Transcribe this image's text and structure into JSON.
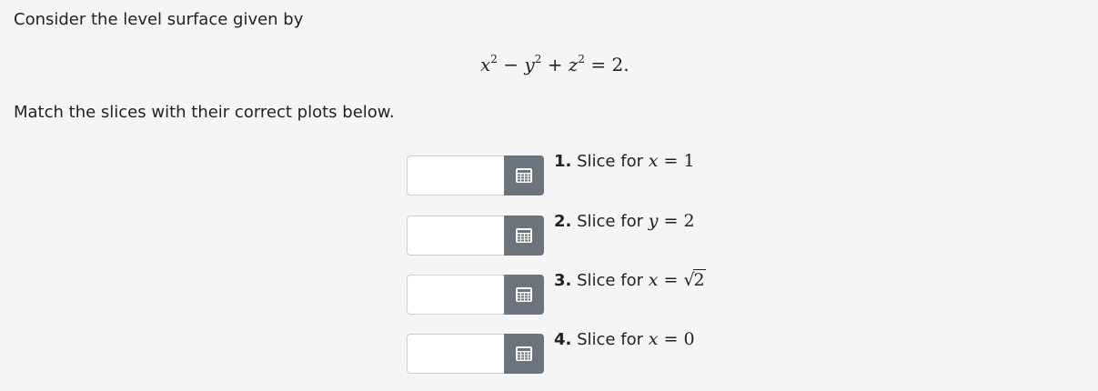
{
  "intro_text": "Consider the level surface given by",
  "equation": {
    "x": "x",
    "minus": " − ",
    "y": "y",
    "plus": " + ",
    "z": "z",
    "exp": "2",
    "equals": " = 2."
  },
  "instructions": "Match the slices with their correct plots below.",
  "slices": [
    {
      "number": "1.",
      "text": "Slice for",
      "variable": "x",
      "equals": " = ",
      "value": "1",
      "input_value": ""
    },
    {
      "number": "2.",
      "text": "Slice for",
      "variable": "y",
      "equals": " = ",
      "value": "2",
      "input_value": ""
    },
    {
      "number": "3.",
      "text": "Slice for",
      "variable": "x",
      "equals": " = ",
      "sqrt_symbol": "√",
      "value": "2",
      "input_value": ""
    },
    {
      "number": "4.",
      "text": "Slice for",
      "variable": "x",
      "equals": " = ",
      "value": "0",
      "input_value": ""
    }
  ],
  "picker_icon": "grid-calendar-icon",
  "colors": {
    "background": "#f5f5f5",
    "button": "#6c757d",
    "input_border": "#cfcfcf"
  }
}
